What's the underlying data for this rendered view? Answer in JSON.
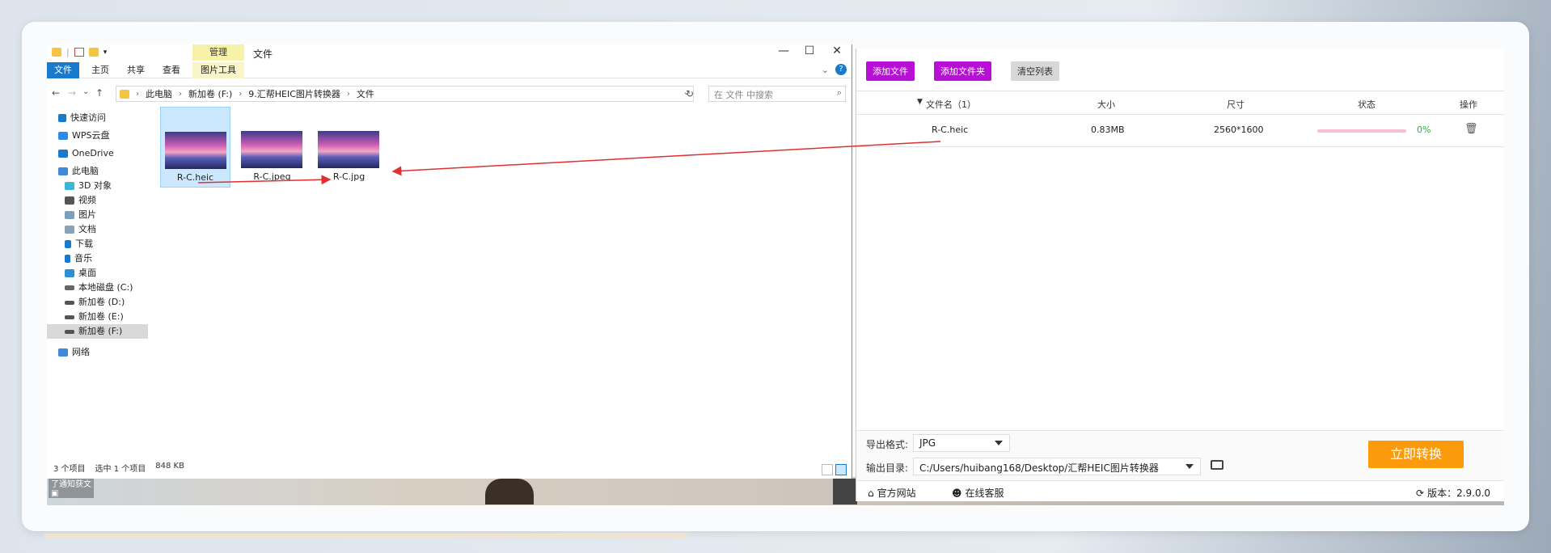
{
  "explorer": {
    "quick_access_sep": "|",
    "manage_tab": "管理",
    "title": "文件",
    "window_controls": {
      "minimize": "—",
      "maximize": "☐",
      "close": "✕"
    },
    "ribbon_tabs": [
      "文件",
      "主页",
      "共享",
      "查看",
      "图片工具"
    ],
    "ribbon_collapse": "⌄",
    "help": "?",
    "nav": {
      "back": "←",
      "forward": "→",
      "recent": "⌄",
      "up": "↑"
    },
    "breadcrumb": [
      "此电脑",
      "新加卷 (F:)",
      "9.汇帮HEIC图片转换器",
      "文件"
    ],
    "breadcrumb_sep": "›",
    "address_dropdown": "⌄",
    "refresh": "↻",
    "search_placeholder": "在 文件 中搜索",
    "search_glyph": "⌕",
    "tree": [
      {
        "label": "快速访问",
        "icon": "star-icon",
        "color": "#1979ca"
      },
      {
        "label": "WPS云盘",
        "icon": "cloud-icon",
        "color": "#2f8bea"
      },
      {
        "label": "OneDrive",
        "icon": "onedrive-icon",
        "color": "#1979ca"
      },
      {
        "label": "此电脑",
        "icon": "computer-icon",
        "color": "#3d8bd8"
      },
      {
        "label": "3D 对象",
        "icon": "cube-icon",
        "color": "#3bb6d6"
      },
      {
        "label": "视频",
        "icon": "video-icon",
        "color": "#555555"
      },
      {
        "label": "图片",
        "icon": "picture-icon",
        "color": "#7a9fbf"
      },
      {
        "label": "文档",
        "icon": "document-icon",
        "color": "#8aa0b6"
      },
      {
        "label": "下载",
        "icon": "download-icon",
        "color": "#1979ca"
      },
      {
        "label": "音乐",
        "icon": "music-icon",
        "color": "#1979ca"
      },
      {
        "label": "桌面",
        "icon": "desktop-icon",
        "color": "#2b8fd6"
      },
      {
        "label": "本地磁盘 (C:)",
        "icon": "drive-icon",
        "color": "#666666"
      },
      {
        "label": "新加卷 (D:)",
        "icon": "drive-icon",
        "color": "#555555"
      },
      {
        "label": "新加卷 (E:)",
        "icon": "drive-icon",
        "color": "#555555"
      },
      {
        "label": "新加卷 (F:)",
        "icon": "drive-icon",
        "color": "#555555"
      },
      {
        "label": "网络",
        "icon": "network-icon",
        "color": "#3d8bd8"
      }
    ],
    "files": [
      "R-C.heic",
      "R-C.jpeg",
      "R-C.jpg"
    ],
    "status": {
      "count": "3 个项目",
      "selected": "选中 1 个项目",
      "size": "848 KB"
    },
    "desktop_icon_label": "了通知获文",
    "desktop_icon_glyph": "▣"
  },
  "app": {
    "buttons": {
      "add_file": "添加文件",
      "add_folder": "添加文件夹",
      "clear": "清空列表"
    },
    "columns": {
      "sort_glyph": "▼",
      "name": "文件名（1）",
      "size": "大小",
      "dims": "尺寸",
      "status": "状态",
      "ops": "操作"
    },
    "row": {
      "name": "R-C.heic",
      "size": "0.83MB",
      "dims": "2560*1600",
      "progress": 0,
      "pct": "0%",
      "delete_glyph": "🗑"
    },
    "output_format_label": "导出格式:",
    "output_format": "JPG",
    "output_dir_label": "输出目录:",
    "output_dir": "C:/Users/huibang168/Desktop/汇帮HEIC图片转换器",
    "convert": "立即转换",
    "footer": {
      "site_icon": "⌂",
      "site": "官方网站",
      "service_icon": "☻",
      "service": "在线客服",
      "version_icon": "⟳",
      "version": "版本：2.9.0.0"
    }
  },
  "colors": {
    "accent_purple": "#b80fd6",
    "convert_orange": "#fb9b0b",
    "progress_green": "#27ae3c",
    "win_blue": "#1979ca",
    "annotation_red": "#e03030"
  }
}
